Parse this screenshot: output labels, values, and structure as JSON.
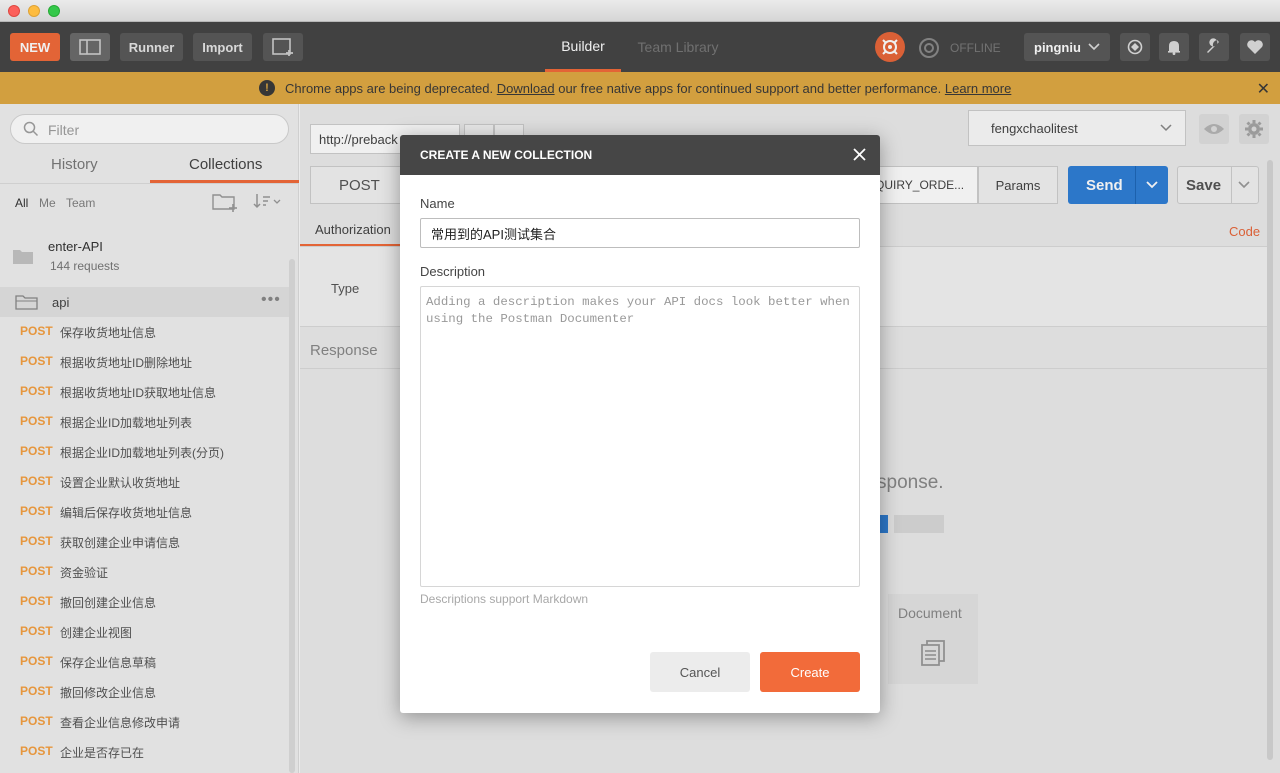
{
  "header": {
    "new_label": "NEW",
    "runner_label": "Runner",
    "import_label": "Import",
    "tabs": [
      {
        "label": "Builder",
        "active": true
      },
      {
        "label": "Team Library",
        "active": false
      }
    ],
    "status_label": "OFFLINE",
    "user_name": "pingniu",
    "icons": [
      "satellite-icon",
      "bell-icon",
      "wrench-icon",
      "heart-icon"
    ]
  },
  "banner": {
    "text_before": "Chrome apps are being deprecated.",
    "download_link": "Download",
    "text_after": "our free native apps for continued support and better performance.",
    "learn_more": "Learn more"
  },
  "sidebar": {
    "filter_placeholder": "Filter",
    "tabs": [
      "History",
      "Collections"
    ],
    "active_tab": "Collections",
    "owner_filters": [
      "All",
      "Me",
      "Team"
    ],
    "collection": {
      "name": "enter-API",
      "count": "144 requests"
    },
    "folder": {
      "name": "api"
    },
    "requests": [
      {
        "method": "POST",
        "name": "保存收货地址信息"
      },
      {
        "method": "POST",
        "name": "根据收货地址ID删除地址"
      },
      {
        "method": "POST",
        "name": "根据收货地址ID获取地址信息"
      },
      {
        "method": "POST",
        "name": "根据企业ID加载地址列表"
      },
      {
        "method": "POST",
        "name": "根据企业ID加载地址列表(分页)"
      },
      {
        "method": "POST",
        "name": "设置企业默认收货地址"
      },
      {
        "method": "POST",
        "name": "编辑后保存收货地址信息"
      },
      {
        "method": "POST",
        "name": "获取创建企业申请信息"
      },
      {
        "method": "POST",
        "name": "资金验证"
      },
      {
        "method": "POST",
        "name": "撤回创建企业信息"
      },
      {
        "method": "POST",
        "name": "创建企业视图"
      },
      {
        "method": "POST",
        "name": "保存企业信息草稿"
      },
      {
        "method": "POST",
        "name": "撤回修改企业信息"
      },
      {
        "method": "POST",
        "name": "查看企业信息修改申请"
      },
      {
        "method": "POST",
        "name": "企业是否存已在"
      }
    ]
  },
  "main": {
    "tab_url": "http://preback",
    "environment": "fengxchaolitest",
    "method": "POST",
    "url_tail": "QUIRY_ORDE...",
    "params_label": "Params",
    "send_label": "Send",
    "save_label": "Save",
    "auth_tab": "Authorization",
    "code_link": "Code",
    "type_label": "Type",
    "response_label": "Response",
    "response_hint": "sponse.",
    "document_label": "Document"
  },
  "modal": {
    "title": "CREATE A NEW COLLECTION",
    "name_label": "Name",
    "name_value": "常用到的API测试集合",
    "description_label": "Description",
    "description_placeholder": "Adding a description makes your API docs look better when using the Postman Documenter",
    "hint": "Descriptions support Markdown",
    "cancel_label": "Cancel",
    "create_label": "Create"
  },
  "colors": {
    "accent": "#f26b3a",
    "header_bg": "#464646",
    "banner_bg": "#e0a943",
    "send_blue": "#2f7fd6",
    "method_orange": "#f5a041"
  }
}
